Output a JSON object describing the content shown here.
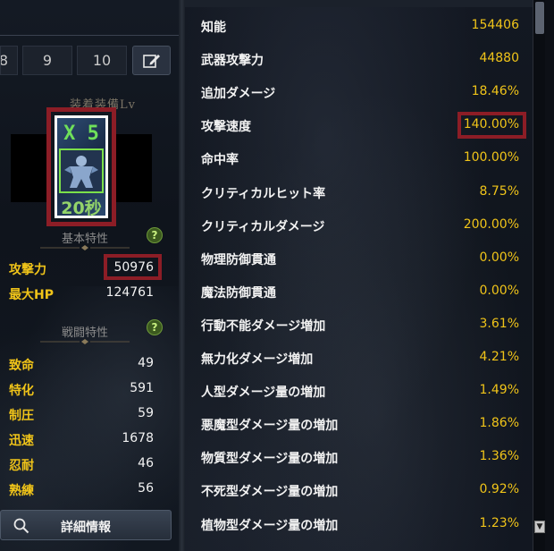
{
  "level_tabs": [
    "8",
    "9",
    "10"
  ],
  "equip_section_title": "装着装備Lv",
  "buff": {
    "stack_count": "X 5",
    "duration": "20秒",
    "icon": "buff-figure-icon"
  },
  "basic_section": {
    "title": "基本特性",
    "help_label": "?",
    "stats": [
      {
        "label": "攻撃力",
        "value": "50976"
      },
      {
        "label": "最大HP",
        "value": "124761"
      }
    ]
  },
  "combat_section": {
    "title": "戦闘特性",
    "help_label": "?",
    "stats": [
      {
        "label": "致命",
        "value": "49"
      },
      {
        "label": "特化",
        "value": "591"
      },
      {
        "label": "制圧",
        "value": "59"
      },
      {
        "label": "迅速",
        "value": "1678"
      },
      {
        "label": "忍耐",
        "value": "46"
      },
      {
        "label": "熟練",
        "value": "56"
      }
    ]
  },
  "detail_button": {
    "label": "詳細情報",
    "icon": "search-icon"
  },
  "details": [
    {
      "label": "知能",
      "value": "154406"
    },
    {
      "label": "武器攻撃力",
      "value": "44880"
    },
    {
      "label": "追加ダメージ",
      "value": "18.46%"
    },
    {
      "label": "攻撃速度",
      "value": "140.00%"
    },
    {
      "label": "命中率",
      "value": "100.00%"
    },
    {
      "label": "クリティカルヒット率",
      "value": "8.75%"
    },
    {
      "label": "クリティカルダメージ",
      "value": "200.00%"
    },
    {
      "label": "物理防御貫通",
      "value": "0.00%"
    },
    {
      "label": "魔法防御貫通",
      "value": "0.00%"
    },
    {
      "label": "行動不能ダメージ増加",
      "value": "3.61%"
    },
    {
      "label": "無力化ダメージ増加",
      "value": "4.21%"
    },
    {
      "label": "人型ダメージ量の増加",
      "value": "1.49%"
    },
    {
      "label": "悪魔型ダメージ量の増加",
      "value": "1.86%"
    },
    {
      "label": "物質型ダメージ量の増加",
      "value": "1.36%"
    },
    {
      "label": "不死型ダメージ量の増加",
      "value": "0.92%"
    },
    {
      "label": "植物型ダメージ量の増加",
      "value": "1.23%"
    }
  ],
  "colors": {
    "stat_label": "#f0c419",
    "stat_value_gold": "#f0c419",
    "highlight_border": "#8c1d26",
    "buff_green": "#6fe05a"
  }
}
